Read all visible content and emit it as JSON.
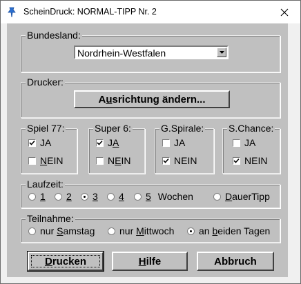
{
  "window": {
    "title": "ScheinDruck: NORMAL-TIPP Nr. 2",
    "icon": "pin-icon",
    "close_icon": "close-icon"
  },
  "bundesland": {
    "label": "Bundesland:",
    "selected": "Nordrhein-Westfalen"
  },
  "drucker": {
    "label": "Drucker:",
    "button_pre": "A",
    "button_accel": "u",
    "button_post": "srichtung ändern..."
  },
  "spiel77": {
    "label": "Spiel 77:",
    "ja": "JA",
    "ja_checked": true,
    "nein_accel": "N",
    "nein_rest": "EIN",
    "nein_checked": false
  },
  "super6": {
    "label": "Super 6:",
    "ja_pre": "J",
    "ja_accel": "A",
    "ja_checked": true,
    "nein_pre": "N",
    "nein_accel": "E",
    "nein_post": "IN",
    "nein_checked": false
  },
  "gspirale": {
    "label": "G.Spirale:",
    "ja": "JA",
    "ja_checked": false,
    "nein": "NEIN",
    "nein_checked": true
  },
  "schance": {
    "label": "S.Chance:",
    "ja": "JA",
    "ja_checked": false,
    "nein": "NEIN",
    "nein_checked": true
  },
  "laufzeit": {
    "label": "Laufzeit:",
    "options": [
      "1",
      "2",
      "3",
      "4",
      "5"
    ],
    "selected": "3",
    "weeks_label": "Wochen",
    "dauer_accel": "D",
    "dauer_rest": "auerTipp"
  },
  "teilnahme": {
    "label": "Teilnahme:",
    "opt1_pre": "nur ",
    "opt1_accel": "S",
    "opt1_post": "amstag",
    "opt2_pre": "nur ",
    "opt2_accel": "M",
    "opt2_post": "ittwoch",
    "opt3_pre": "an ",
    "opt3_accel": "b",
    "opt3_post": "eiden Tagen",
    "selected": 3
  },
  "buttons": {
    "print_accel": "D",
    "print_rest": "rucken",
    "help_accel": "H",
    "help_rest": "ilfe",
    "cancel": "Abbruch"
  }
}
